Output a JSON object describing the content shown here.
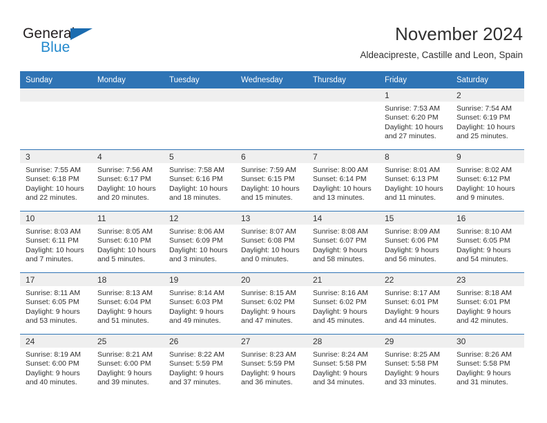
{
  "logo": {
    "word_one": "General",
    "word_two": "Blue",
    "triangle_icon": "triangle-icon",
    "brand_blue": "#2389cd",
    "triangle_blue": "#1b6cb0"
  },
  "header": {
    "title": "November 2024",
    "subtitle": "Aldeacipreste, Castille and Leon, Spain",
    "header_bg": "#2f74b5",
    "daynum_bg": "#efefef"
  },
  "columns": [
    "Sunday",
    "Monday",
    "Tuesday",
    "Wednesday",
    "Thursday",
    "Friday",
    "Saturday"
  ],
  "labels": {
    "sunrise_prefix": "Sunrise:",
    "sunset_prefix": "Sunset:",
    "daylight_prefix": "Daylight:"
  },
  "weeks": [
    [
      {
        "day": "",
        "sunrise": "",
        "sunset": "",
        "daylight": ""
      },
      {
        "day": "",
        "sunrise": "",
        "sunset": "",
        "daylight": ""
      },
      {
        "day": "",
        "sunrise": "",
        "sunset": "",
        "daylight": ""
      },
      {
        "day": "",
        "sunrise": "",
        "sunset": "",
        "daylight": ""
      },
      {
        "day": "",
        "sunrise": "",
        "sunset": "",
        "daylight": ""
      },
      {
        "day": "1",
        "sunrise": "Sunrise: 7:53 AM",
        "sunset": "Sunset: 6:20 PM",
        "daylight": "Daylight: 10 hours and 27 minutes."
      },
      {
        "day": "2",
        "sunrise": "Sunrise: 7:54 AM",
        "sunset": "Sunset: 6:19 PM",
        "daylight": "Daylight: 10 hours and 25 minutes."
      }
    ],
    [
      {
        "day": "3",
        "sunrise": "Sunrise: 7:55 AM",
        "sunset": "Sunset: 6:18 PM",
        "daylight": "Daylight: 10 hours and 22 minutes."
      },
      {
        "day": "4",
        "sunrise": "Sunrise: 7:56 AM",
        "sunset": "Sunset: 6:17 PM",
        "daylight": "Daylight: 10 hours and 20 minutes."
      },
      {
        "day": "5",
        "sunrise": "Sunrise: 7:58 AM",
        "sunset": "Sunset: 6:16 PM",
        "daylight": "Daylight: 10 hours and 18 minutes."
      },
      {
        "day": "6",
        "sunrise": "Sunrise: 7:59 AM",
        "sunset": "Sunset: 6:15 PM",
        "daylight": "Daylight: 10 hours and 15 minutes."
      },
      {
        "day": "7",
        "sunrise": "Sunrise: 8:00 AM",
        "sunset": "Sunset: 6:14 PM",
        "daylight": "Daylight: 10 hours and 13 minutes."
      },
      {
        "day": "8",
        "sunrise": "Sunrise: 8:01 AM",
        "sunset": "Sunset: 6:13 PM",
        "daylight": "Daylight: 10 hours and 11 minutes."
      },
      {
        "day": "9",
        "sunrise": "Sunrise: 8:02 AM",
        "sunset": "Sunset: 6:12 PM",
        "daylight": "Daylight: 10 hours and 9 minutes."
      }
    ],
    [
      {
        "day": "10",
        "sunrise": "Sunrise: 8:03 AM",
        "sunset": "Sunset: 6:11 PM",
        "daylight": "Daylight: 10 hours and 7 minutes."
      },
      {
        "day": "11",
        "sunrise": "Sunrise: 8:05 AM",
        "sunset": "Sunset: 6:10 PM",
        "daylight": "Daylight: 10 hours and 5 minutes."
      },
      {
        "day": "12",
        "sunrise": "Sunrise: 8:06 AM",
        "sunset": "Sunset: 6:09 PM",
        "daylight": "Daylight: 10 hours and 3 minutes."
      },
      {
        "day": "13",
        "sunrise": "Sunrise: 8:07 AM",
        "sunset": "Sunset: 6:08 PM",
        "daylight": "Daylight: 10 hours and 0 minutes."
      },
      {
        "day": "14",
        "sunrise": "Sunrise: 8:08 AM",
        "sunset": "Sunset: 6:07 PM",
        "daylight": "Daylight: 9 hours and 58 minutes."
      },
      {
        "day": "15",
        "sunrise": "Sunrise: 8:09 AM",
        "sunset": "Sunset: 6:06 PM",
        "daylight": "Daylight: 9 hours and 56 minutes."
      },
      {
        "day": "16",
        "sunrise": "Sunrise: 8:10 AM",
        "sunset": "Sunset: 6:05 PM",
        "daylight": "Daylight: 9 hours and 54 minutes."
      }
    ],
    [
      {
        "day": "17",
        "sunrise": "Sunrise: 8:11 AM",
        "sunset": "Sunset: 6:05 PM",
        "daylight": "Daylight: 9 hours and 53 minutes."
      },
      {
        "day": "18",
        "sunrise": "Sunrise: 8:13 AM",
        "sunset": "Sunset: 6:04 PM",
        "daylight": "Daylight: 9 hours and 51 minutes."
      },
      {
        "day": "19",
        "sunrise": "Sunrise: 8:14 AM",
        "sunset": "Sunset: 6:03 PM",
        "daylight": "Daylight: 9 hours and 49 minutes."
      },
      {
        "day": "20",
        "sunrise": "Sunrise: 8:15 AM",
        "sunset": "Sunset: 6:02 PM",
        "daylight": "Daylight: 9 hours and 47 minutes."
      },
      {
        "day": "21",
        "sunrise": "Sunrise: 8:16 AM",
        "sunset": "Sunset: 6:02 PM",
        "daylight": "Daylight: 9 hours and 45 minutes."
      },
      {
        "day": "22",
        "sunrise": "Sunrise: 8:17 AM",
        "sunset": "Sunset: 6:01 PM",
        "daylight": "Daylight: 9 hours and 44 minutes."
      },
      {
        "day": "23",
        "sunrise": "Sunrise: 8:18 AM",
        "sunset": "Sunset: 6:01 PM",
        "daylight": "Daylight: 9 hours and 42 minutes."
      }
    ],
    [
      {
        "day": "24",
        "sunrise": "Sunrise: 8:19 AM",
        "sunset": "Sunset: 6:00 PM",
        "daylight": "Daylight: 9 hours and 40 minutes."
      },
      {
        "day": "25",
        "sunrise": "Sunrise: 8:21 AM",
        "sunset": "Sunset: 6:00 PM",
        "daylight": "Daylight: 9 hours and 39 minutes."
      },
      {
        "day": "26",
        "sunrise": "Sunrise: 8:22 AM",
        "sunset": "Sunset: 5:59 PM",
        "daylight": "Daylight: 9 hours and 37 minutes."
      },
      {
        "day": "27",
        "sunrise": "Sunrise: 8:23 AM",
        "sunset": "Sunset: 5:59 PM",
        "daylight": "Daylight: 9 hours and 36 minutes."
      },
      {
        "day": "28",
        "sunrise": "Sunrise: 8:24 AM",
        "sunset": "Sunset: 5:58 PM",
        "daylight": "Daylight: 9 hours and 34 minutes."
      },
      {
        "day": "29",
        "sunrise": "Sunrise: 8:25 AM",
        "sunset": "Sunset: 5:58 PM",
        "daylight": "Daylight: 9 hours and 33 minutes."
      },
      {
        "day": "30",
        "sunrise": "Sunrise: 8:26 AM",
        "sunset": "Sunset: 5:58 PM",
        "daylight": "Daylight: 9 hours and 31 minutes."
      }
    ]
  ]
}
